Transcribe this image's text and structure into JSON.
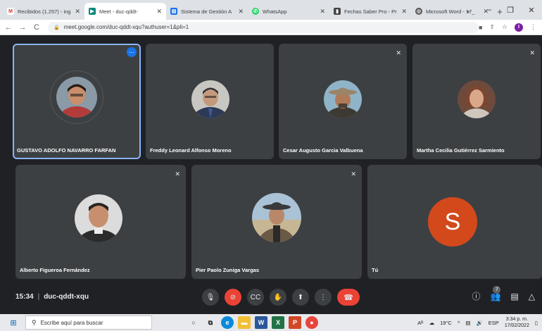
{
  "browser": {
    "tabs": [
      {
        "title": "Recibidos (1.257) - ing",
        "favicon": "gmail-icon",
        "color": "#d93025",
        "active": false
      },
      {
        "title": "Meet - duc-qddt-",
        "favicon": "meet-icon",
        "color": "#00897b",
        "active": true
      },
      {
        "title": "Sistema de Gestión A",
        "favicon": "document-icon",
        "color": "#1a73e8",
        "active": false
      },
      {
        "title": "WhatsApp",
        "favicon": "whatsapp-icon",
        "color": "#25d366",
        "active": false
      },
      {
        "title": "Fechas Saber Pro - Pr",
        "favicon": "ms-icon",
        "color": "#444444",
        "active": false
      },
      {
        "title": "Microsoft Word - 17_",
        "favicon": "globe-icon",
        "color": "#555555",
        "active": false
      }
    ],
    "url": "meet.google.com/duc-qddt-xqu?authuser=1&pli=1",
    "profile_initial": "I"
  },
  "participants": [
    {
      "name": "GUSTAVO ADOLFO NAVARRO FARFAN",
      "muted": false,
      "pinned": true
    },
    {
      "name": "Freddy Leonard Alfonso Moreno",
      "muted": false,
      "pinned": false
    },
    {
      "name": "Cesar Augusto Garcia Valbuena",
      "muted": true,
      "pinned": false
    },
    {
      "name": "Martha Cecilia Gutiérrez Sarmiento",
      "muted": true,
      "pinned": false
    },
    {
      "name": "Alberto Figueroa Fernández",
      "muted": true,
      "pinned": false
    },
    {
      "name": "Pier Paolo Zuniga Vargas",
      "muted": true,
      "pinned": false
    },
    {
      "name": "Tú",
      "muted": false,
      "pinned": false,
      "initial": "S",
      "color": "#d3491b"
    }
  ],
  "meeting": {
    "time": "15:34",
    "code": "duc-qddt-xqu",
    "people_count": "7"
  },
  "taskbar": {
    "search_placeholder": "Escribe aquí para buscar",
    "weather": "19°C",
    "lang": "ESP",
    "time": "3:34 p. m.",
    "date": "17/02/2022"
  }
}
